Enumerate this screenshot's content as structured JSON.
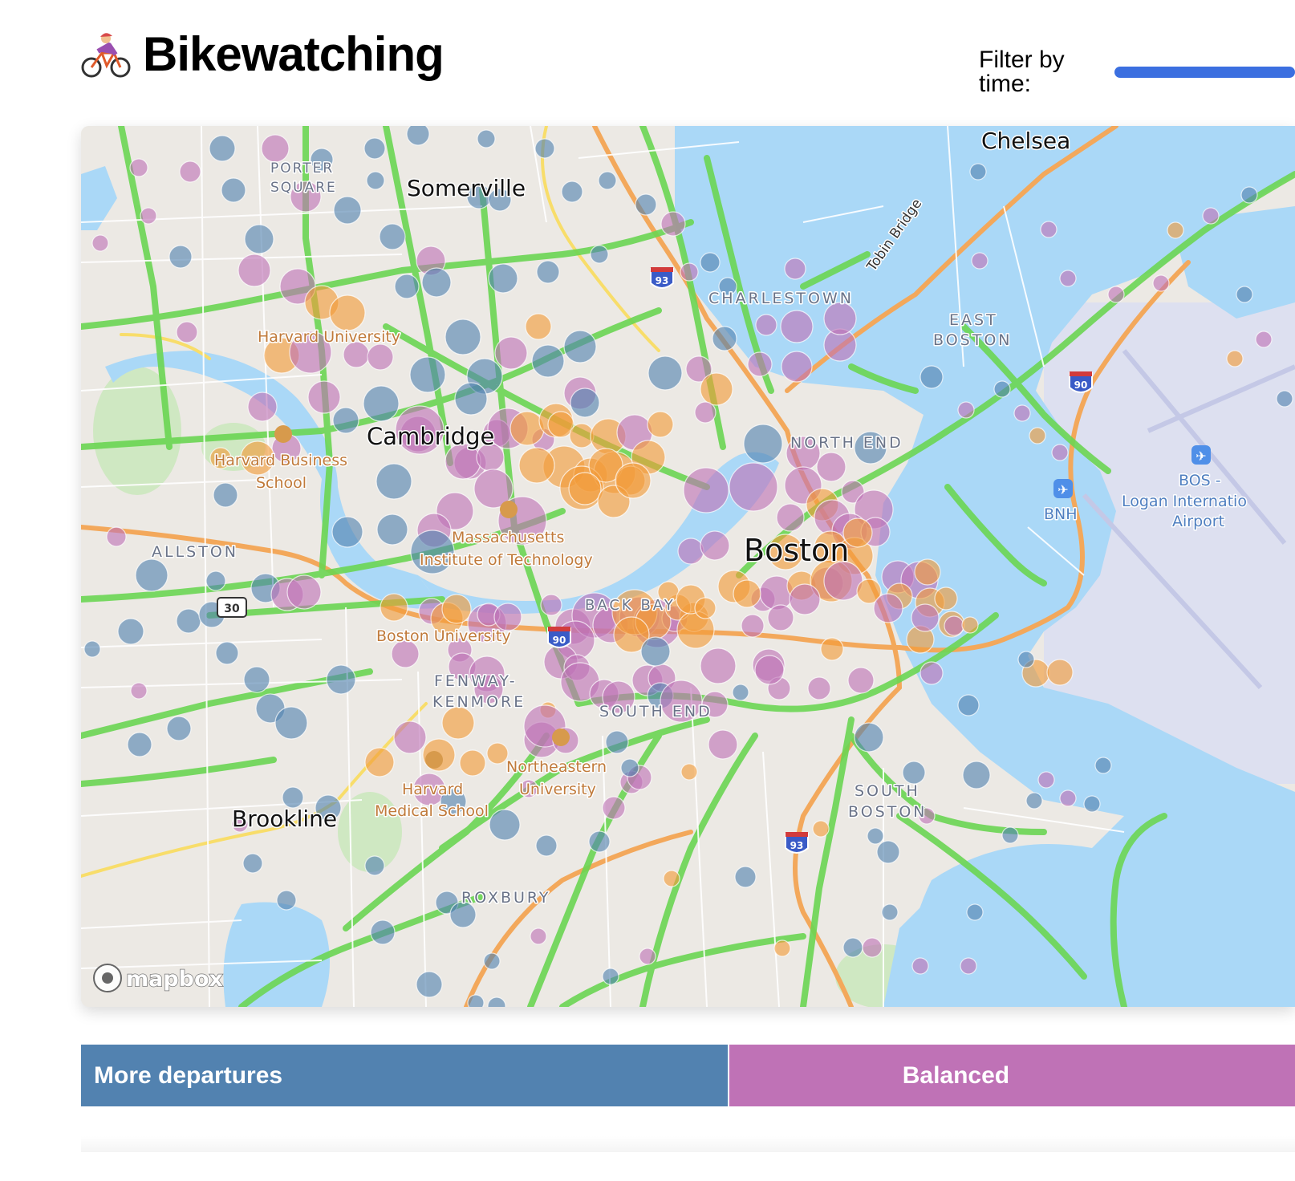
{
  "header": {
    "title": "Bikewatching",
    "cyclist_icon": "woman-biking-emoji",
    "filter_label": "Filter by time:"
  },
  "map": {
    "attribution": "mapbox",
    "places": {
      "chelsea": "Chelsea",
      "somerville": "Somerville",
      "porter_square_1": "PORTER",
      "porter_square_2": "SQUARE",
      "charlestown": "CHARLESTOWN",
      "east_boston_1": "EAST",
      "east_boston_2": "BOSTON",
      "harvard_university": "Harvard University",
      "cambridge": "Cambridge",
      "north_end": "NORTH END",
      "hbs_1": "Harvard Business",
      "hbs_2": "School",
      "mit_1": "Massachusetts",
      "mit_2": "Institute of Technology",
      "allston": "ALLSTON",
      "boston": "Boston",
      "back_bay": "BACK BAY",
      "boston_university": "Boston University",
      "fenway_1": "FENWAY-",
      "fenway_2": "KENMORE",
      "south_end": "SOUTH END",
      "northeastern_1": "Northeastern",
      "northeastern_2": "University",
      "hms_1": "Harvard",
      "hms_2": "Medical School",
      "brookline": "Brookline",
      "south_boston_1": "SOUTH",
      "south_boston_2": "BOSTON",
      "roxbury": "ROXBURY",
      "bnh": "BNH",
      "bos_1": "BOS -",
      "bos_2": "Logan Internatio",
      "bos_3": "Airport",
      "tobin_bridge": "Tobin Bridge"
    },
    "route_shields": {
      "i93_north": "93",
      "i93_south": "93",
      "i90_east": "90",
      "i90_west": "90",
      "route30": "30"
    },
    "colors": {
      "water": "#aad8f7",
      "land": "#ece9e4",
      "bike_lanes": "#6bd653",
      "highway": "#f3a85b",
      "more_departures": "#5282b0",
      "balanced": "#bf72b6",
      "more_arrivals": "#f29b38"
    }
  },
  "legend": {
    "more_departures": "More departures",
    "balanced": "Balanced"
  }
}
